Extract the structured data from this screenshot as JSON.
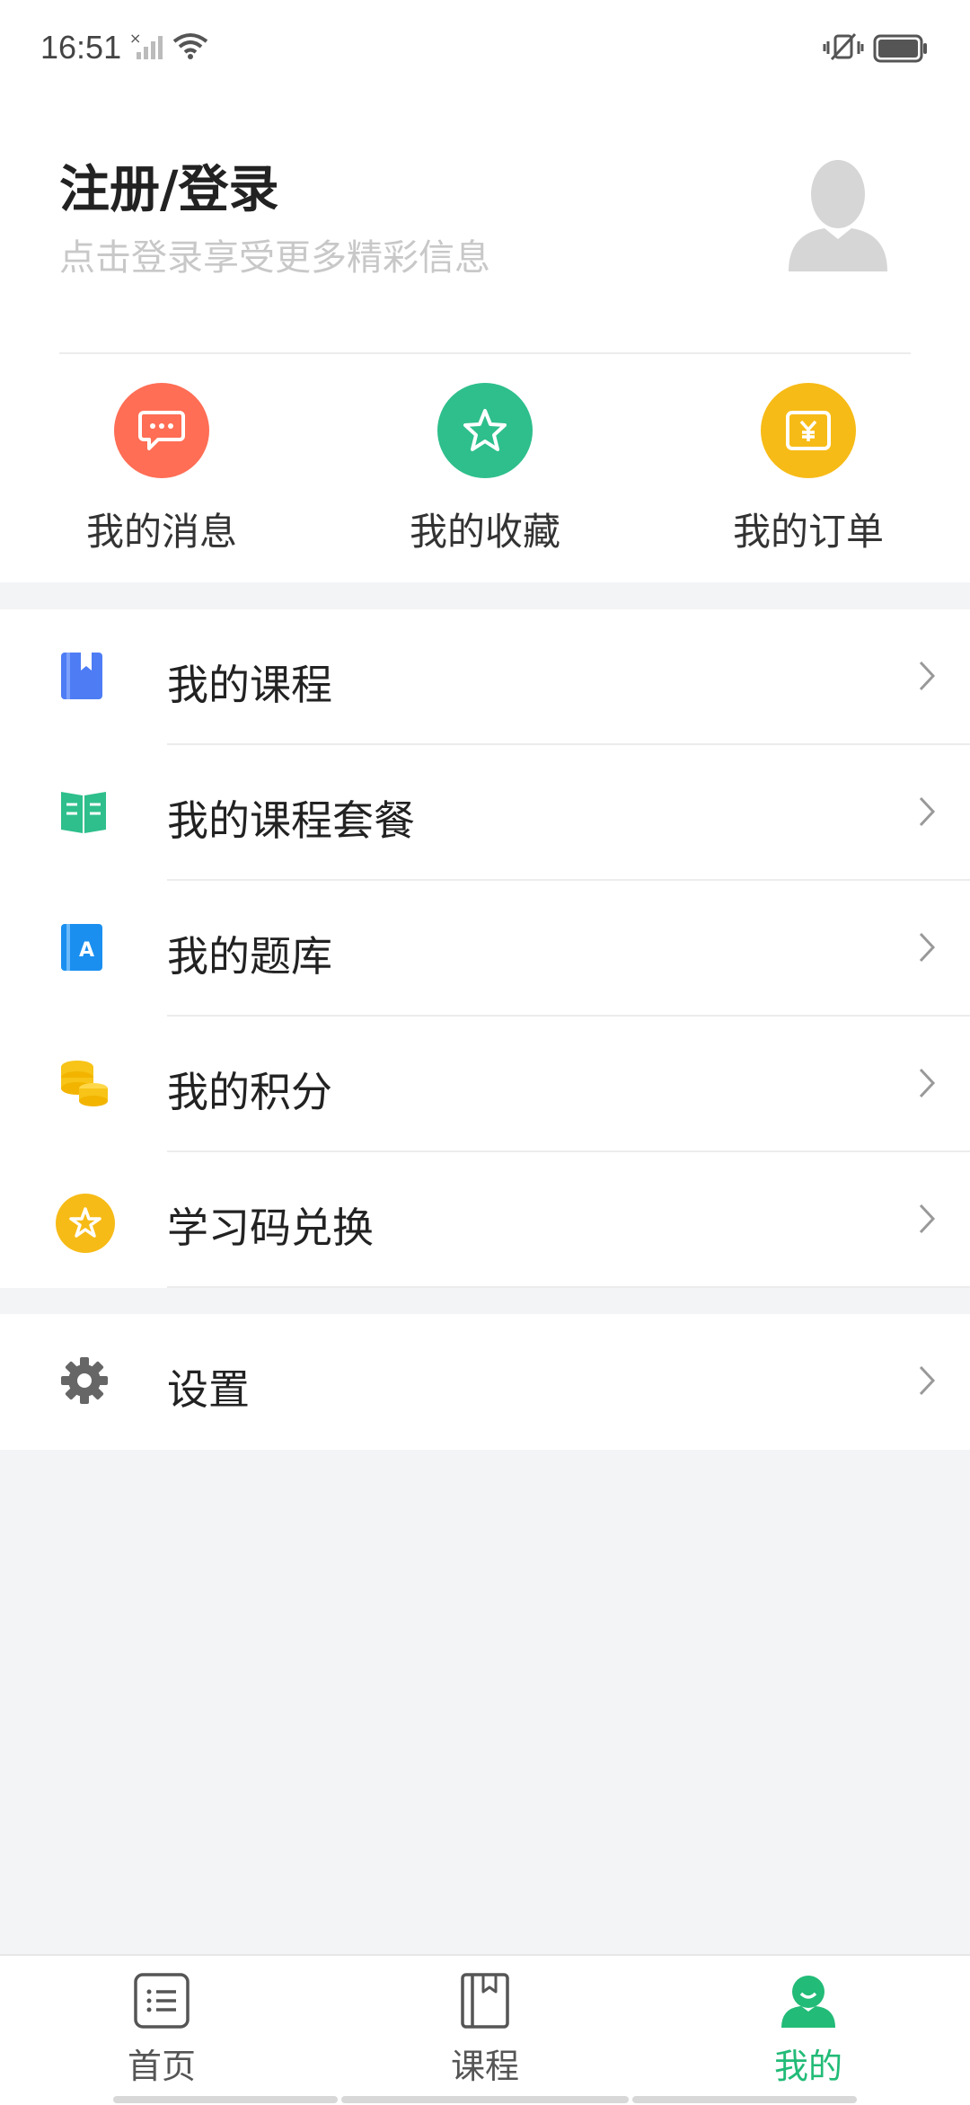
{
  "status": {
    "time": "16:51"
  },
  "profile": {
    "title": "注册/登录",
    "subtitle": "点击登录享受更多精彩信息"
  },
  "quick_actions": [
    {
      "label": "我的消息",
      "icon": "message-icon",
      "color": "#ff6e55"
    },
    {
      "label": "我的收藏",
      "icon": "star-icon",
      "color": "#2ebf8c"
    },
    {
      "label": "我的订单",
      "icon": "order-yen-icon",
      "color": "#f7bb17"
    }
  ],
  "menu": {
    "items": [
      {
        "label": "我的课程",
        "icon": "bookmark-book-icon",
        "color": "#4d7cf5"
      },
      {
        "label": "我的课程套餐",
        "icon": "open-book-icon",
        "color": "#2ebf8c"
      },
      {
        "label": "我的题库",
        "icon": "question-bank-icon",
        "color": "#1a8ff0"
      },
      {
        "label": "我的积分",
        "icon": "coins-icon",
        "color": "#f7c417"
      },
      {
        "label": "学习码兑换",
        "icon": "star-badge-icon",
        "color": "#f7bb17"
      }
    ],
    "settings": {
      "label": "设置",
      "icon": "gear-icon",
      "color": "#666666"
    }
  },
  "tabbar": {
    "tabs": [
      {
        "label": "首页",
        "icon": "list-icon"
      },
      {
        "label": "课程",
        "icon": "book-icon"
      },
      {
        "label": "我的",
        "icon": "user-icon"
      }
    ],
    "active_color": "#22bb77"
  }
}
